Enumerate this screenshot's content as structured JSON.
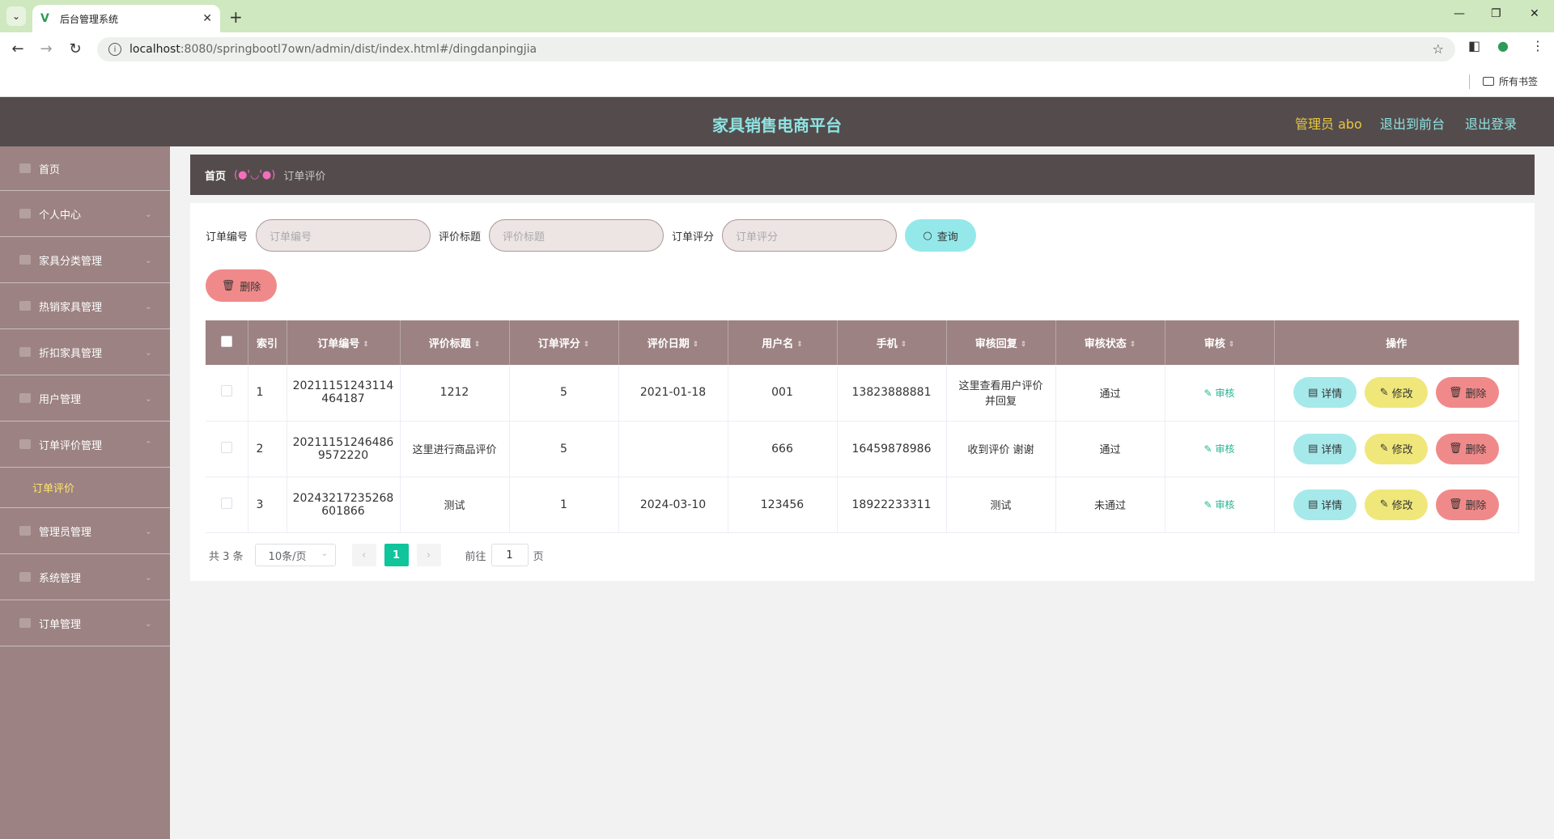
{
  "browser": {
    "tab_title": "后台管理系统",
    "url_host": "localhost",
    "url_path": ":8080/springbootl7own/admin/dist/index.html#/dingdanpingjia",
    "bookmarks_label": "所有书签"
  },
  "header": {
    "title": "家具销售电商平台",
    "admin": "管理员 abo",
    "to_front": "退出到前台",
    "logout": "退出登录"
  },
  "sidebar": {
    "items": [
      {
        "label": "首页"
      },
      {
        "label": "个人中心"
      },
      {
        "label": "家具分类管理"
      },
      {
        "label": "热销家具管理"
      },
      {
        "label": "折扣家具管理"
      },
      {
        "label": "用户管理"
      },
      {
        "label": "订单评价管理"
      },
      {
        "label": "管理员管理"
      },
      {
        "label": "系统管理"
      },
      {
        "label": "订单管理"
      }
    ],
    "active_sub": "订单评价"
  },
  "breadcrumb": {
    "home": "首页",
    "face": "(●'◡'●)",
    "current": "订单评价"
  },
  "search": {
    "order_no_label": "订单编号",
    "order_no_placeholder": "订单编号",
    "title_label": "评价标题",
    "title_placeholder": "评价标题",
    "score_label": "订单评分",
    "score_placeholder": "订单评分",
    "query_btn": "查询"
  },
  "actions": {
    "delete_btn": "删除"
  },
  "table": {
    "headers": [
      "索引",
      "订单编号",
      "评价标题",
      "订单评分",
      "评价日期",
      "用户名",
      "手机",
      "审核回复",
      "审核状态",
      "审核",
      "操作"
    ],
    "rows": [
      {
        "idx": "1",
        "order_no_1": "20211151243114",
        "order_no_2": "464187",
        "title": "1212",
        "score": "5",
        "date": "2021-01-18",
        "user": "001",
        "phone": "13823888881",
        "reply_1": "这里查看用户评价",
        "reply_2": "并回复",
        "status": "通过"
      },
      {
        "idx": "2",
        "order_no_1": "20211151246486",
        "order_no_2": "9572220",
        "title": "这里进行商品评价",
        "score": "5",
        "date": "",
        "user": "666",
        "phone": "16459878986",
        "reply_1": "收到评价 谢谢",
        "reply_2": "",
        "status": "通过"
      },
      {
        "idx": "3",
        "order_no_1": "20243217235268",
        "order_no_2": "601866",
        "title": "测试",
        "score": "1",
        "date": "2024-03-10",
        "user": "123456",
        "phone": "18922233311",
        "reply_1": "测试",
        "reply_2": "",
        "status": "未通过"
      }
    ],
    "audit_label": "审核",
    "detail_btn": "详情",
    "edit_btn": "修改",
    "row_delete_btn": "删除"
  },
  "pager": {
    "total": "共 3 条",
    "page_size": "10条/页",
    "current_page": "1",
    "goto_label": "前往",
    "goto_value": "1",
    "page_unit": "页"
  },
  "colors": {
    "header_bg": "#544c4c",
    "sidebar_bg": "#9c8282",
    "title_accent": "#8fe3e3",
    "admin_accent": "#e8c840",
    "pager_active": "#10c49b"
  }
}
